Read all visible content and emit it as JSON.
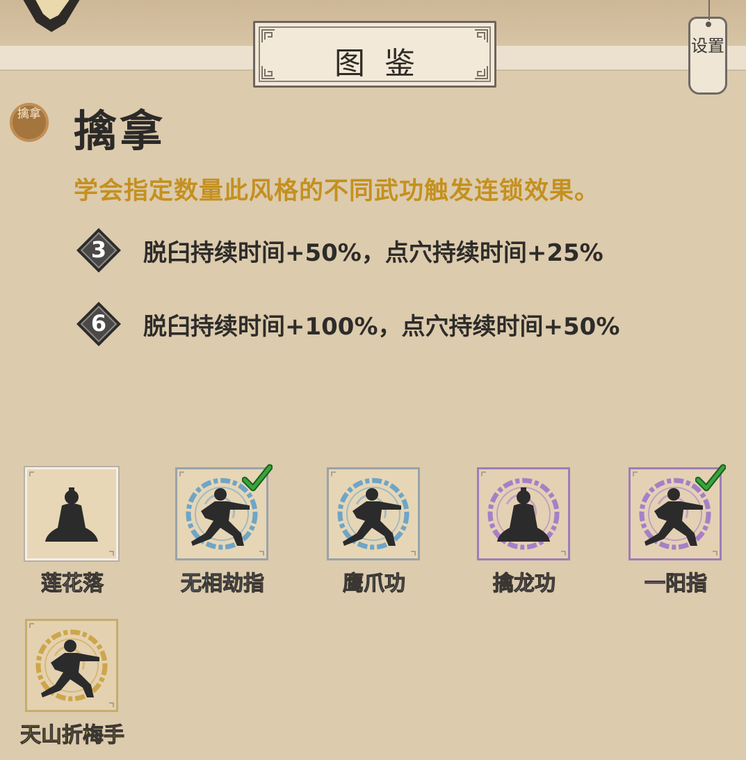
{
  "header": {
    "title": "图鉴",
    "settings_label": "设置"
  },
  "style": {
    "badge_text": "擒拿",
    "name": "擒拿",
    "description": "学会指定数量此风格的不同武功触发连锁效果。"
  },
  "tiers": [
    {
      "count": "3",
      "effect": "脱臼持续时间+50%，点穴持续时间+25%"
    },
    {
      "count": "6",
      "effect": "脱臼持续时间+100%，点穴持续时间+50%"
    }
  ],
  "skills": [
    {
      "name": "莲花落",
      "rarity": "white",
      "learned": false,
      "pose": "seated",
      "name_color": "#f4efe6"
    },
    {
      "name": "无相劫指",
      "rarity": "blue",
      "learned": true,
      "pose": "stance",
      "name_color": "#9bc1dc"
    },
    {
      "name": "鹰爪功",
      "rarity": "blue",
      "learned": false,
      "pose": "stance",
      "name_color": "#9bc1dc"
    },
    {
      "name": "擒龙功",
      "rarity": "purple",
      "learned": false,
      "pose": "seated",
      "name_color": "#b692d6"
    },
    {
      "name": "一阳指",
      "rarity": "purple",
      "learned": true,
      "pose": "stance",
      "name_color": "#b692d6"
    },
    {
      "name": "天山折梅手",
      "rarity": "gold",
      "learned": false,
      "pose": "stance",
      "name_color": "#e3b43c"
    }
  ],
  "colors": {
    "background": "#dccbad",
    "description": "#c4901f",
    "check": "#37a538"
  }
}
